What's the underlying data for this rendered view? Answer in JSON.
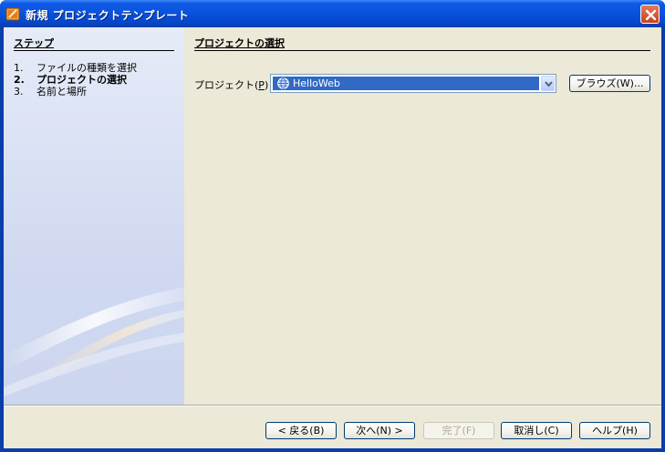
{
  "window": {
    "title": "新規 プロジェクトテンプレート"
  },
  "steps": {
    "heading": "ステップ",
    "items": [
      {
        "num": "1.",
        "label": "ファイルの種類を選択"
      },
      {
        "num": "2.",
        "label": "プロジェクトの選択"
      },
      {
        "num": "3.",
        "label": "名前と場所"
      }
    ],
    "current_index": 1
  },
  "main": {
    "heading": "プロジェクトの選択",
    "project_label_prefix": "プロジェクト(",
    "project_label_mnemonic": "P",
    "project_label_suffix": ") :",
    "project_selected": "HelloWeb",
    "browse_button": "ブラウズ(W)..."
  },
  "buttons": {
    "back": "< 戻る(B)",
    "next": "次へ(N) >",
    "finish": "完了(F)",
    "cancel": "取消し(C)",
    "help": "ヘルプ(H)"
  },
  "colors": {
    "titlebar": "#0a53dd",
    "selection": "#316ac5",
    "dialog_face": "#ece9d8",
    "steps_panel": "#d9e1f4"
  },
  "icons": {
    "app": "java-cup-icon",
    "close": "close-icon",
    "project": "globe-icon",
    "dropdown": "chevron-down-icon"
  }
}
